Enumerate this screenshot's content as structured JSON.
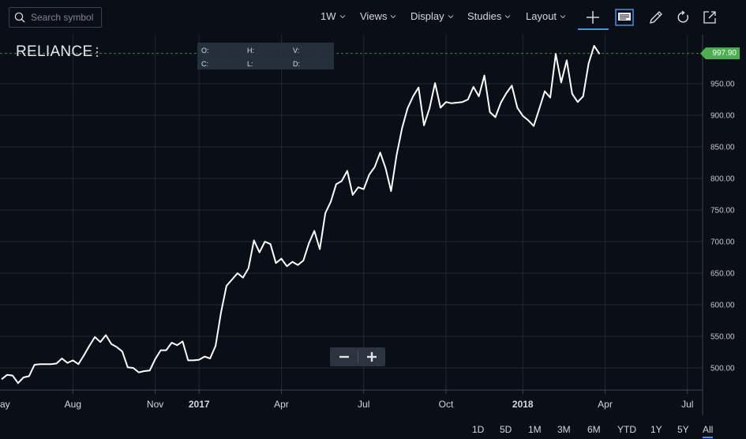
{
  "toolbar": {
    "search_placeholder": "Search symbol",
    "interval_label": "1W",
    "views_label": "Views",
    "display_label": "Display",
    "studies_label": "Studies",
    "layout_label": "Layout",
    "icons": [
      "search-icon",
      "crosshair-plus-icon",
      "news-icon",
      "pencil-icon",
      "refresh-icon",
      "popout-icon"
    ]
  },
  "legend": {
    "open_label": "O:",
    "high_label": "H:",
    "volume_label": "V:",
    "close_label": "C:",
    "low_label": "L:",
    "date_label": "D:"
  },
  "symbol": "RELIANCE",
  "last_price_label": "997.90",
  "colors": {
    "line": "#ffffff",
    "price_tag": "#4caf50",
    "grid": "#1e2a33",
    "background": "#0a0e16",
    "accent": "#4a90e2"
  },
  "range_buttons": [
    "1D",
    "5D",
    "1M",
    "3M",
    "6M",
    "YTD",
    "1Y",
    "5Y",
    "All"
  ],
  "active_range": "All",
  "chart_data": {
    "type": "line",
    "symbol": "RELIANCE",
    "ylim": [
      460,
      1000
    ],
    "y_ticks": [
      "500.00",
      "550.00",
      "600.00",
      "650.00",
      "700.00",
      "750.00",
      "800.00",
      "850.00",
      "900.00",
      "950.00"
    ],
    "y_tick_values": [
      500,
      550,
      600,
      650,
      700,
      750,
      800,
      850,
      900,
      950
    ],
    "x_ticks": [
      "ay",
      "Aug",
      "Nov",
      "2017",
      "Apr",
      "Jul",
      "Oct",
      "2018",
      "Apr",
      "Jul"
    ],
    "x_tick_weeks": [
      0,
      13,
      28,
      36,
      51,
      66,
      81,
      95,
      110,
      125
    ],
    "bold_x_ticks": [
      "2017",
      "2018"
    ],
    "last_price": 997.9,
    "grid": true,
    "series": [
      {
        "x_week": [
          0,
          1,
          2,
          3,
          4,
          5,
          6,
          7,
          8,
          9,
          10,
          11,
          12,
          13,
          14,
          15,
          16,
          17,
          18,
          19,
          20,
          21,
          22,
          23,
          24,
          25,
          26,
          27,
          28,
          29,
          30,
          31,
          32,
          33,
          34,
          35,
          36,
          37,
          38,
          39,
          40,
          41,
          42,
          43,
          44,
          45,
          46,
          47,
          48,
          49,
          50,
          51,
          52,
          53,
          54,
          55,
          56,
          57,
          58,
          59,
          60,
          61,
          62,
          63,
          64,
          65,
          66,
          67,
          68,
          69,
          70,
          71,
          72,
          73,
          74,
          75,
          76,
          77,
          78,
          79,
          80,
          81,
          82,
          83,
          84,
          85,
          86,
          87,
          88,
          89,
          90,
          91,
          92,
          93,
          94,
          95,
          96,
          97,
          98,
          99,
          100,
          101,
          102,
          103,
          104,
          105,
          106,
          107,
          108,
          109,
          110,
          111,
          112,
          113,
          114,
          115,
          116,
          117,
          118,
          119,
          120,
          121,
          122,
          123,
          124,
          125
        ],
        "y": [
          482,
          489,
          488,
          476,
          485,
          487,
          505,
          506,
          506,
          506,
          507,
          515,
          508,
          512,
          506,
          520,
          535,
          549,
          541,
          552,
          538,
          533,
          526,
          501,
          500,
          493,
          495,
          496,
          514,
          528,
          528,
          540,
          536,
          542,
          512,
          512,
          513,
          518,
          515,
          535,
          588,
          630,
          640,
          650,
          643,
          658,
          702,
          683,
          700,
          696,
          666,
          673,
          661,
          668,
          663,
          670,
          697,
          717,
          688,
          745,
          763,
          791,
          796,
          812,
          774,
          786,
          783,
          806,
          818,
          841,
          816,
          780,
          837,
          880,
          911,
          930,
          944,
          884,
          911,
          951,
          912,
          921,
          919,
          920,
          921,
          925,
          945,
          930,
          963,
          905,
          897,
          920,
          935,
          947,
          912,
          899,
          892,
          883,
          910,
          938,
          928,
          997,
          952,
          987,
          934,
          921,
          930,
          982,
          1010,
          997
        ]
      }
    ]
  }
}
